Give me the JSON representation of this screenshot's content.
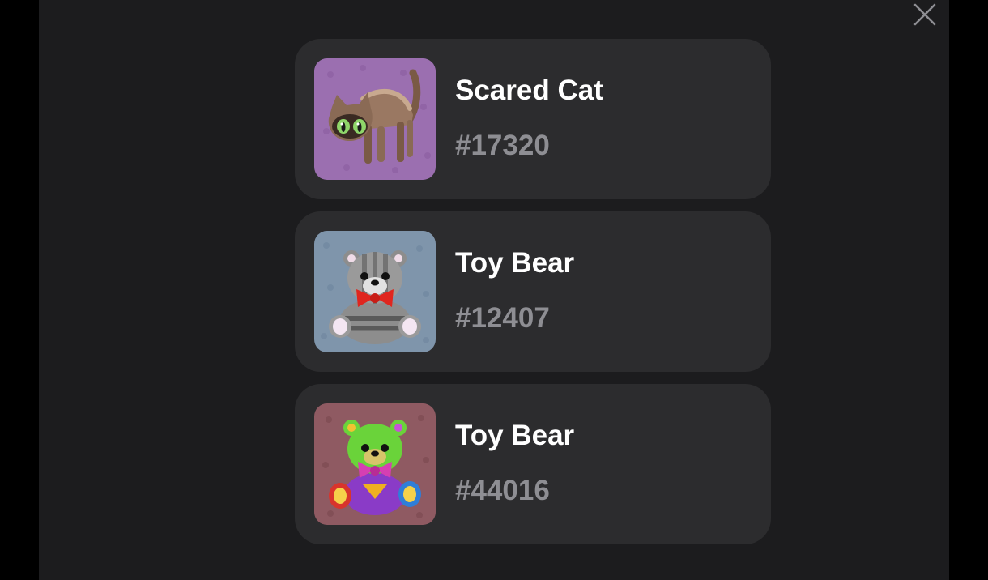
{
  "modal": {
    "close_icon": "close-icon",
    "items": [
      {
        "title": "Scared Cat",
        "number": "#17320",
        "background": "#9b6fb0",
        "icon": "scared-cat-icon"
      },
      {
        "title": "Toy Bear",
        "number": "#12407",
        "background": "#7f95ab",
        "icon": "gray-toy-bear-icon"
      },
      {
        "title": "Toy Bear",
        "number": "#44016",
        "background": "#8f5a62",
        "icon": "green-toy-bear-icon"
      }
    ]
  },
  "colors": {
    "page_background": "#000000",
    "panel_background": "#1c1c1e",
    "card_background": "#2c2c2e",
    "title_text": "#ffffff",
    "number_text": "#8e8e93"
  }
}
